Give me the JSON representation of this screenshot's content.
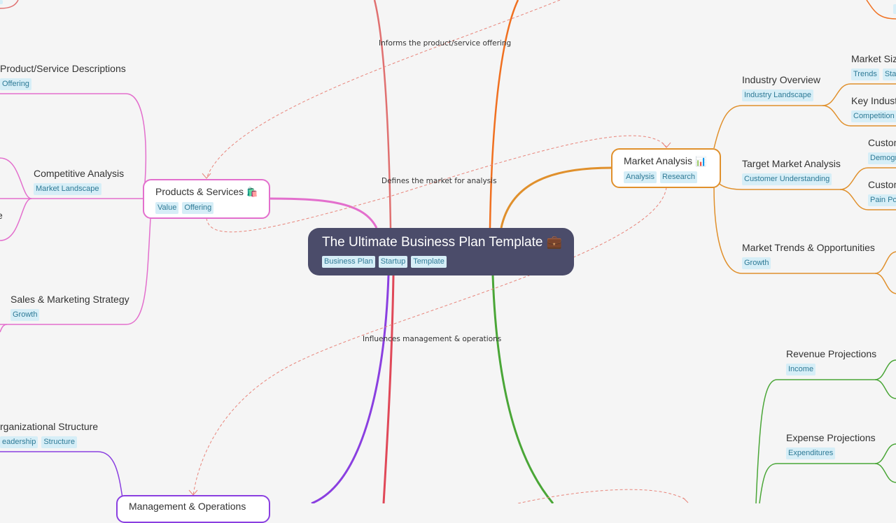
{
  "colors": {
    "background": "#f5f5f5",
    "root_fill": "#4b4c6a",
    "tag_bg": "#d6eef7",
    "tag_text": "#2e7a96",
    "products_branch": "#e36fcd",
    "market_branch": "#e0902c",
    "management_branch": "#8a3fe0",
    "financial_branch": "#4aa637",
    "top_orange_branch": "#f07020",
    "top_red_branch": "#e07070",
    "bottom_red_branch": "#e04858",
    "relation_line": "#e8847a"
  },
  "root": {
    "title": "The Ultimate Business Plan Template",
    "icon": "briefcase-icon",
    "icon_glyph": "💼",
    "tags": [
      "Business Plan",
      "Startup",
      "Template"
    ]
  },
  "products": {
    "title": "Products & Services",
    "icon": "shopping-bags-icon",
    "icon_glyph": "🛍️",
    "tags": [
      "Value",
      "Offering"
    ],
    "children": [
      {
        "title": "Product/Service Descriptions",
        "tags": [
          "Offering"
        ]
      },
      {
        "title": "Competitive Analysis",
        "tags": [
          "Market Landscape"
        ]
      },
      {
        "title": "Sales & Marketing Strategy",
        "tags": [
          "Growth"
        ]
      }
    ]
  },
  "market": {
    "title": "Market Analysis",
    "icon": "bar-chart-icon",
    "icon_glyph": "📊",
    "tags": [
      "Analysis",
      "Research"
    ],
    "children": [
      {
        "title": "Industry Overview",
        "tags": [
          "Industry Landscape"
        ],
        "children": [
          {
            "title": "Market Size",
            "tags": [
              "Trends",
              "Stat"
            ]
          },
          {
            "title": "Key Indust",
            "tags": [
              "Competition"
            ]
          }
        ]
      },
      {
        "title": "Target Market Analysis",
        "tags": [
          "Customer Understanding"
        ],
        "children": [
          {
            "title": "Custom",
            "tags": [
              "Demogr"
            ]
          },
          {
            "title": "Custom",
            "tags": [
              "Pain Poi"
            ]
          }
        ]
      },
      {
        "title": "Market Trends & Opportunities",
        "tags": [
          "Growth"
        ]
      }
    ]
  },
  "management": {
    "title": "Management & Operations",
    "children": [
      {
        "title": "rganizational Structure",
        "tags": [
          "eadership",
          "Structure"
        ]
      }
    ]
  },
  "financial": {
    "children": [
      {
        "title": "Revenue Projections",
        "tags": [
          "Income"
        ]
      },
      {
        "title": "Expense Projections",
        "tags": [
          "Expenditures"
        ]
      }
    ]
  },
  "relations": [
    {
      "label": "Informs the product/service offering"
    },
    {
      "label": "Defines the market for analysis"
    },
    {
      "label": "Influences management & operations"
    }
  ]
}
